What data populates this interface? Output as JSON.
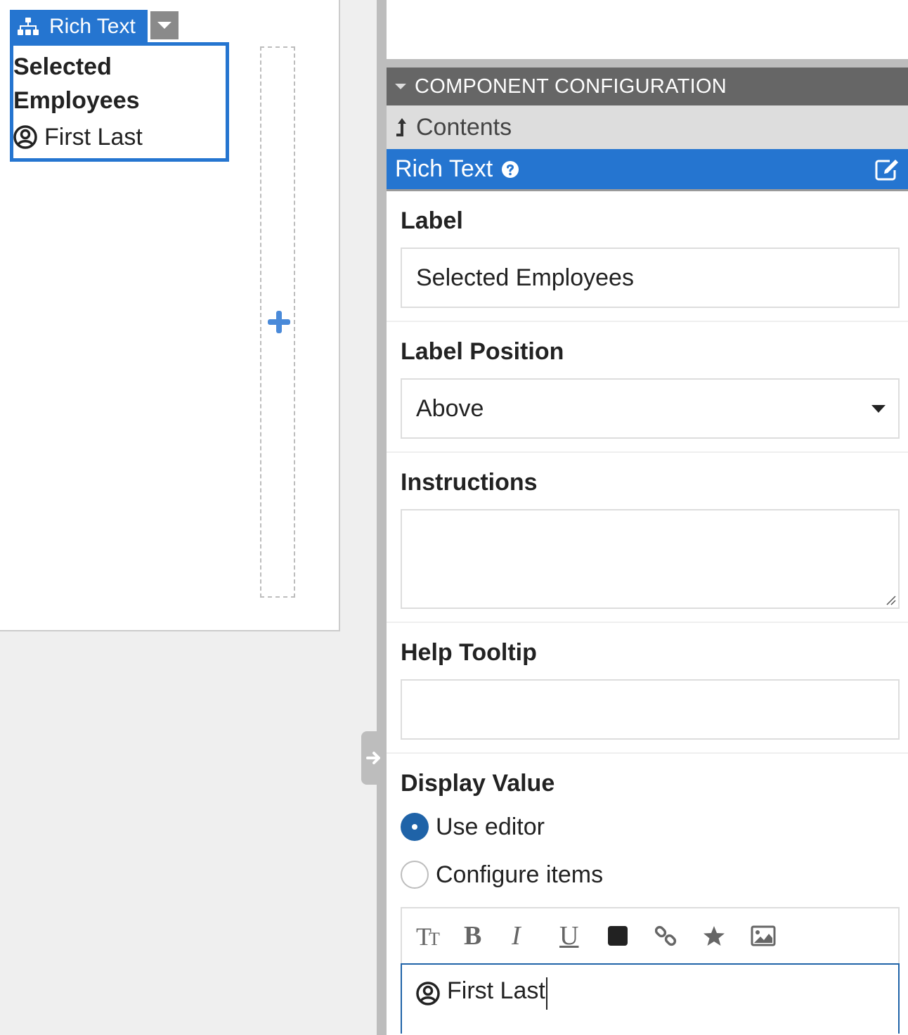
{
  "canvas": {
    "component_tab_label": "Rich Text",
    "component_title": "Selected Employees",
    "person_name": "First Last",
    "add_icon": "plus-icon"
  },
  "panel": {
    "section_header": "COMPONENT CONFIGURATION",
    "contents_link": "Contents",
    "component_type": "Rich Text",
    "fields": {
      "label": {
        "title": "Label",
        "value": "Selected Employees"
      },
      "label_position": {
        "title": "Label Position",
        "value": "Above"
      },
      "instructions": {
        "title": "Instructions",
        "value": ""
      },
      "help_tooltip": {
        "title": "Help Tooltip",
        "value": ""
      },
      "display_value": {
        "title": "Display Value",
        "options": [
          {
            "label": "Use editor",
            "selected": true
          },
          {
            "label": "Configure items",
            "selected": false
          }
        ]
      }
    },
    "editor": {
      "toolbar": [
        "text-size",
        "bold",
        "italic",
        "underline",
        "text-color",
        "link",
        "star",
        "image"
      ],
      "tb_text_size": "TT",
      "tb_bold": "B",
      "tb_italic": "I",
      "tb_underline": "U",
      "content": "First Last",
      "text_color": "#222222"
    }
  },
  "colors": {
    "accent": "#2575d0",
    "radio_selected": "#1f63a8",
    "header_bg": "#666666"
  }
}
